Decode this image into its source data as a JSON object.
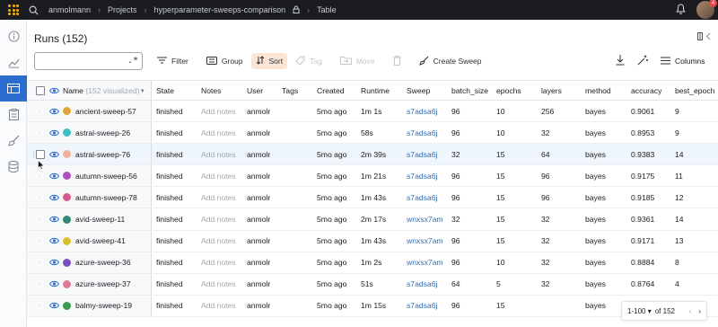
{
  "topbar": {
    "breadcrumbs": [
      "anmolmann",
      "Projects",
      "hyperparameter-sweeps-comparison",
      "Table"
    ],
    "notification_count": "4"
  },
  "page": {
    "title_prefix": "Runs",
    "title_count": "(152)"
  },
  "search": {
    "value": "",
    "placeholder": "",
    "regex_label": ".*"
  },
  "toolbar": {
    "filter": "Filter",
    "group": "Group",
    "sort": "Sort",
    "tag": "Tag",
    "move": "Move",
    "create_sweep": "Create Sweep",
    "columns": "Columns"
  },
  "table": {
    "name_header": "Name",
    "visualized": "(152 visualized)",
    "columns": [
      "State",
      "Notes",
      "User",
      "Tags",
      "Created",
      "Runtime",
      "Sweep",
      "batch_size",
      "epochs",
      "layers",
      "method",
      "accuracy",
      "best_epoch"
    ],
    "rows": [
      {
        "name": "ancient-sweep-57",
        "color": "#e0a53a",
        "state": "finished",
        "notes": "Add notes",
        "user": "anmolr",
        "tags": "",
        "created": "5mo ago",
        "runtime": "1m 1s",
        "sweep": "s7adsa6j",
        "batch_size": "96",
        "epochs": "10",
        "layers": "256",
        "method": "bayes",
        "accuracy": "0.9061",
        "best_epoch": "9"
      },
      {
        "name": "astral-sweep-26",
        "color": "#3fbfc4",
        "state": "finished",
        "notes": "Add notes",
        "user": "anmolr",
        "tags": "",
        "created": "5mo ago",
        "runtime": "58s",
        "sweep": "s7adsa6j",
        "batch_size": "96",
        "epochs": "10",
        "layers": "32",
        "method": "bayes",
        "accuracy": "0.8953",
        "best_epoch": "9"
      },
      {
        "name": "astral-sweep-76",
        "color": "#f2b39b",
        "state": "finished",
        "notes": "Add notes",
        "user": "anmolr",
        "tags": "",
        "created": "5mo ago",
        "runtime": "2m 39s",
        "sweep": "s7adsa6j",
        "batch_size": "32",
        "epochs": "15",
        "layers": "64",
        "method": "bayes",
        "accuracy": "0.9383",
        "best_epoch": "14"
      },
      {
        "name": "autumn-sweep-56",
        "color": "#b04fc0",
        "state": "finished",
        "notes": "Add notes",
        "user": "anmolr",
        "tags": "",
        "created": "5mo ago",
        "runtime": "1m 21s",
        "sweep": "s7adsa6j",
        "batch_size": "96",
        "epochs": "15",
        "layers": "96",
        "method": "bayes",
        "accuracy": "0.9175",
        "best_epoch": "11"
      },
      {
        "name": "autumn-sweep-78",
        "color": "#d65a8c",
        "state": "finished",
        "notes": "Add notes",
        "user": "anmolr",
        "tags": "",
        "created": "5mo ago",
        "runtime": "1m 43s",
        "sweep": "s7adsa6j",
        "batch_size": "96",
        "epochs": "15",
        "layers": "96",
        "method": "bayes",
        "accuracy": "0.9185",
        "best_epoch": "12"
      },
      {
        "name": "avid-sweep-11",
        "color": "#2e8a70",
        "state": "finished",
        "notes": "Add notes",
        "user": "anmolr",
        "tags": "",
        "created": "5mo ago",
        "runtime": "2m 17s",
        "sweep": "wnxsx7am",
        "batch_size": "32",
        "epochs": "15",
        "layers": "32",
        "method": "bayes",
        "accuracy": "0.9361",
        "best_epoch": "14"
      },
      {
        "name": "avid-sweep-41",
        "color": "#d8c02a",
        "state": "finished",
        "notes": "Add notes",
        "user": "anmolr",
        "tags": "",
        "created": "5mo ago",
        "runtime": "1m 43s",
        "sweep": "wnxsx7am",
        "batch_size": "96",
        "epochs": "15",
        "layers": "32",
        "method": "bayes",
        "accuracy": "0.9171",
        "best_epoch": "13"
      },
      {
        "name": "azure-sweep-36",
        "color": "#7a4fc0",
        "state": "finished",
        "notes": "Add notes",
        "user": "anmolr",
        "tags": "",
        "created": "5mo ago",
        "runtime": "1m 2s",
        "sweep": "wnxsx7am",
        "batch_size": "96",
        "epochs": "10",
        "layers": "32",
        "method": "bayes",
        "accuracy": "0.8884",
        "best_epoch": "8"
      },
      {
        "name": "azure-sweep-37",
        "color": "#e07a9a",
        "state": "finished",
        "notes": "Add notes",
        "user": "anmolr",
        "tags": "",
        "created": "5mo ago",
        "runtime": "51s",
        "sweep": "s7adsa6j",
        "batch_size": "64",
        "epochs": "5",
        "layers": "32",
        "method": "bayes",
        "accuracy": "0.8764",
        "best_epoch": "4"
      },
      {
        "name": "balmy-sweep-19",
        "color": "#3a9a4a",
        "state": "finished",
        "notes": "Add notes",
        "user": "anmolr",
        "tags": "",
        "created": "5mo ago",
        "runtime": "1m 15s",
        "sweep": "s7adsa6j",
        "batch_size": "96",
        "epochs": "15",
        "layers": "",
        "method": "bayes",
        "accuracy": "",
        "best_epoch": ""
      }
    ]
  },
  "pager": {
    "range": "1-100",
    "of_label": "of 152"
  },
  "colors": {
    "accent": "#2b6cd1",
    "sort_bg": "#fbe6d6",
    "link": "#2f6fb5"
  },
  "icons": [
    "search-icon",
    "info-icon",
    "chart-icon",
    "table-icon",
    "report-icon",
    "sweep-icon",
    "artifacts-icon",
    "bell-icon",
    "filter-icon",
    "group-icon",
    "sort-icon",
    "tag-icon",
    "move-icon",
    "delete-icon",
    "broom-icon",
    "download-icon",
    "magic-icon",
    "columns-icon",
    "eye-icon",
    "lock-icon"
  ]
}
